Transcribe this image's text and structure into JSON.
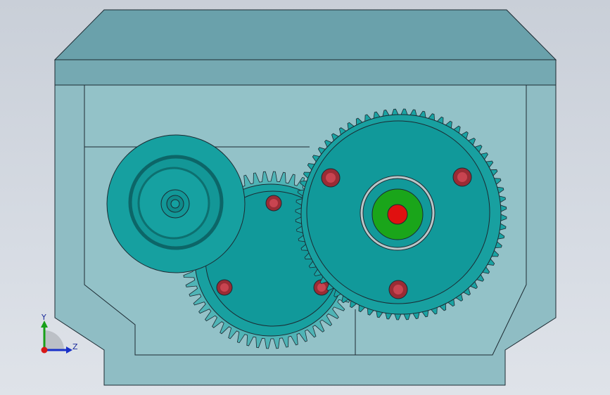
{
  "viewport": {
    "background_top": "#c9cfd8",
    "background_bottom": "#dfe3e9"
  },
  "model": {
    "housing_color": "#6fa3ac",
    "housing_light": "#8dbcc2",
    "gear_color": "#139c9c",
    "gear_dark": "#0d7d7e",
    "hub_green": "#1aa51a",
    "shaft_red": "#e01010",
    "bolt_color": "#b0333d",
    "edge_color": "#1c2a32"
  },
  "triad": {
    "y_label": "Y",
    "z_label": "Z",
    "x_color": "#d81818",
    "y_color": "#18a018",
    "z_color": "#1830c8"
  }
}
